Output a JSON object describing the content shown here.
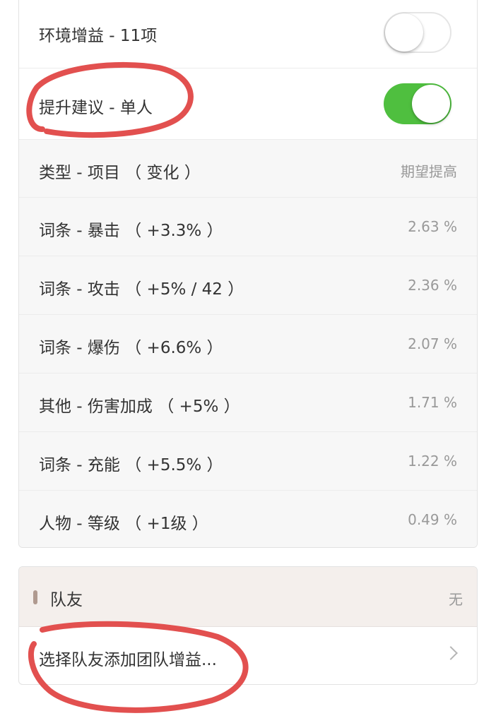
{
  "settings": {
    "env_buff_label": "环境增益 - 11项",
    "env_buff_on": false,
    "suggestion_label": "提升建议 - 单人",
    "suggestion_on": true
  },
  "table": {
    "header": {
      "label": "类型 - 项目 （ 变化 ）",
      "value": "期望提高"
    },
    "rows": [
      {
        "label": "词条 - 暴击 （ +3.3% ）",
        "value": "2.63 %"
      },
      {
        "label": "词条 - 攻击 （ +5% / 42 ）",
        "value": "2.36 %"
      },
      {
        "label": "词条 - 爆伤 （ +6.6% ）",
        "value": "2.07 %"
      },
      {
        "label": "其他 - 伤害加成 （ +5% ）",
        "value": "1.71 %"
      },
      {
        "label": "词条 - 充能 （ +5.5% ）",
        "value": "1.22 %"
      },
      {
        "label": "人物 - 等级 （ +1级 ）",
        "value": "0.49 %"
      }
    ]
  },
  "team": {
    "title": "队友",
    "status": "无",
    "add_label": "选择队友添加团队增益..."
  },
  "colors": {
    "toggle_on": "#4fbf3f",
    "annotation": "#e2504f"
  },
  "icons": {
    "chevron": "chevron-right-icon"
  }
}
